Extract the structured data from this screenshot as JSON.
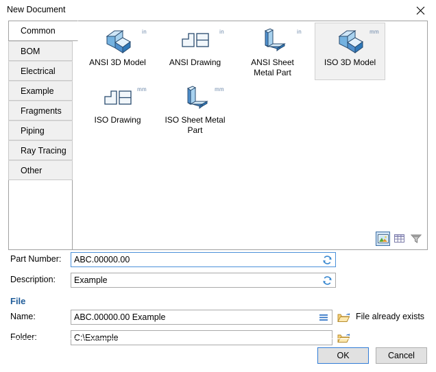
{
  "window": {
    "title": "New Document",
    "close_icon": "close-icon"
  },
  "tabs": [
    {
      "label": "Common",
      "selected": true
    },
    {
      "label": "BOM",
      "selected": false
    },
    {
      "label": "Electrical",
      "selected": false
    },
    {
      "label": "Example",
      "selected": false
    },
    {
      "label": "Fragments",
      "selected": false
    },
    {
      "label": "Piping",
      "selected": false
    },
    {
      "label": "Ray Tracing",
      "selected": false
    },
    {
      "label": "Other",
      "selected": false
    }
  ],
  "templates": [
    {
      "label": "ANSI 3D Model",
      "unit": "in",
      "icon": "model-3d-icon",
      "selected": false
    },
    {
      "label": "ANSI Drawing",
      "unit": "in",
      "icon": "drawing-icon",
      "selected": false
    },
    {
      "label": "ANSI Sheet Metal Part",
      "unit": "in",
      "icon": "sheet-metal-icon",
      "selected": false
    },
    {
      "label": "ISO 3D Model",
      "unit": "mm",
      "icon": "model-3d-icon",
      "selected": true
    },
    {
      "label": "ISO Drawing",
      "unit": "mm",
      "icon": "drawing-icon",
      "selected": false
    },
    {
      "label": "ISO Sheet Metal Part",
      "unit": "mm",
      "icon": "sheet-metal-icon",
      "selected": false
    }
  ],
  "view_toolbar": [
    {
      "name": "thumbnail-view-icon",
      "active": true
    },
    {
      "name": "details-view-icon",
      "active": false
    },
    {
      "name": "filter-icon",
      "active": false
    }
  ],
  "form": {
    "part_number": {
      "label": "Part Number:",
      "value": "ABC.00000.00",
      "placeholder": "",
      "focused": true,
      "action_icon": "refresh-icon"
    },
    "description": {
      "label": "Description:",
      "value": "Example",
      "placeholder": "",
      "focused": false,
      "action_icon": "refresh-icon"
    }
  },
  "file_section": {
    "header": "File",
    "name": {
      "label": "Name:",
      "value": "ABC.00000.00 Example",
      "placeholder": "",
      "menu_icon": "menu-icon",
      "browse_icon": "folder-open-icon"
    },
    "folder": {
      "label": "Folder:",
      "value": "C:\\Example",
      "placeholder": "",
      "browse_icon": "folder-open-icon"
    },
    "status": "File already exists"
  },
  "buttons": {
    "ok": "OK",
    "cancel": "Cancel"
  },
  "colors": {
    "accent": "#1f5c99",
    "focus_border": "#4a90d9",
    "icon_blue": "#4f90cd",
    "icon_outline": "#27496d",
    "folder_yellow": "#e8b63a",
    "selected_bg": "#f1f1f1"
  }
}
